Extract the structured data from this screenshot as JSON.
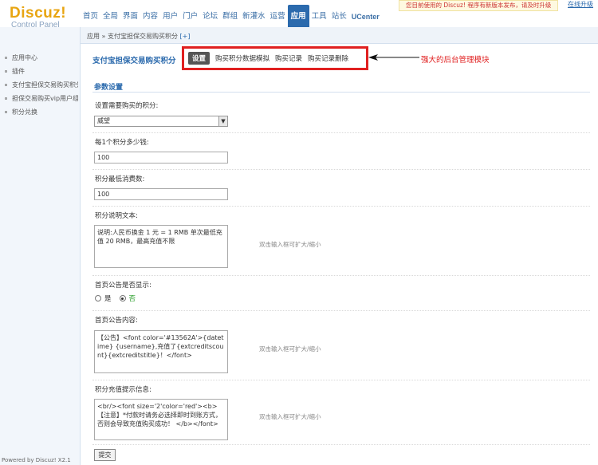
{
  "header": {
    "logo_main": "Discuz!",
    "logo_sub": "Control Panel",
    "nav": [
      "首页",
      "全局",
      "界面",
      "内容",
      "用户",
      "门户",
      "论坛",
      "群组",
      "新灌水",
      "运营",
      "应用",
      "工具",
      "站长",
      "UCenter"
    ],
    "active_nav": "应用",
    "notice": "您目前使用的 Discuz! 程序有新版本发布，请及时升级",
    "check_link": "在线升级"
  },
  "sidebar": {
    "items": [
      "应用中心",
      "插件",
      "支付宝担保交易购买积分",
      "担保交易购买vip用户组",
      "积分兑换"
    ],
    "powered": "Powered by Discuz! X2.1"
  },
  "breadcrumb": {
    "text": "应用 » 支付宝担保交易购买积分",
    "plus": "[+]"
  },
  "module": {
    "title": "支付宝担保交易购买积分",
    "tabs": [
      "设置",
      "购买积分数据模拟",
      "购买记录",
      "购买记录删除"
    ],
    "active_tab": "设置",
    "annotation": "强大的后台管理模块",
    "annotation_color": "#e02020"
  },
  "form": {
    "section_title": "参数设置",
    "credit_label": "设置需要购买的积分:",
    "credit_value": "威望",
    "price_label": "每1个积分多少钱:",
    "price_value": "100",
    "min_label": "积分最低消费数:",
    "min_value": "100",
    "desc_label": "积分说明文本:",
    "desc_value": "说明:人民币换金 1 元 = 1 RMB 单次最低充值 20 RMB，最高充值不限",
    "expand_hint": "双击输入框可扩大/缩小",
    "show_label": "首页公告是否显示:",
    "radio_yes": "是",
    "radio_no": "否",
    "announce_label": "首页公告内容:",
    "announce_value": "【公告】<font color='#13562A'>{datetime} {username},充值了{extcreditscount}{extcreditstitle}！</font>",
    "tip_label": "积分充值提示信息:",
    "tip_value": "<br/><font size='2'color='red'><b>【注意】*付款时请务必选择即时到账方式，否则会导致充值购买成功！ </b></font>",
    "submit_label": "提交"
  }
}
